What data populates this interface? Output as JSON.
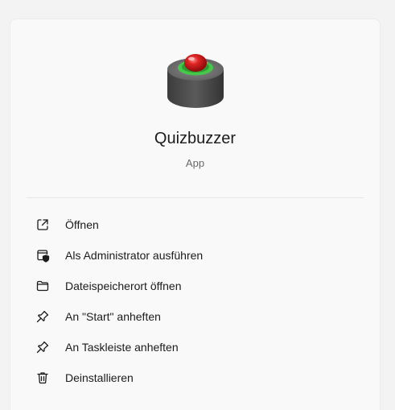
{
  "app": {
    "title": "Quizbuzzer",
    "subtitle": "App",
    "icon": "quiz-buzzer-icon"
  },
  "menu": {
    "items": [
      {
        "label": "Öffnen",
        "icon": "open-external-icon"
      },
      {
        "label": "Als Administrator ausführen",
        "icon": "admin-shield-icon"
      },
      {
        "label": "Dateispeicherort öffnen",
        "icon": "folder-icon"
      },
      {
        "label": "An \"Start\" anheften",
        "icon": "pin-icon"
      },
      {
        "label": "An Taskleiste anheften",
        "icon": "pin-icon"
      },
      {
        "label": "Deinstallieren",
        "icon": "trash-icon"
      }
    ]
  },
  "colors": {
    "panel_bg": "#f9f9f9",
    "page_bg": "#f3f3f3",
    "text": "#1b1b1b",
    "subtext": "#6a6a6a",
    "buzzer_red": "#d01818",
    "buzzer_ring": "#45c84a",
    "buzzer_body": "#4a4a4a"
  }
}
